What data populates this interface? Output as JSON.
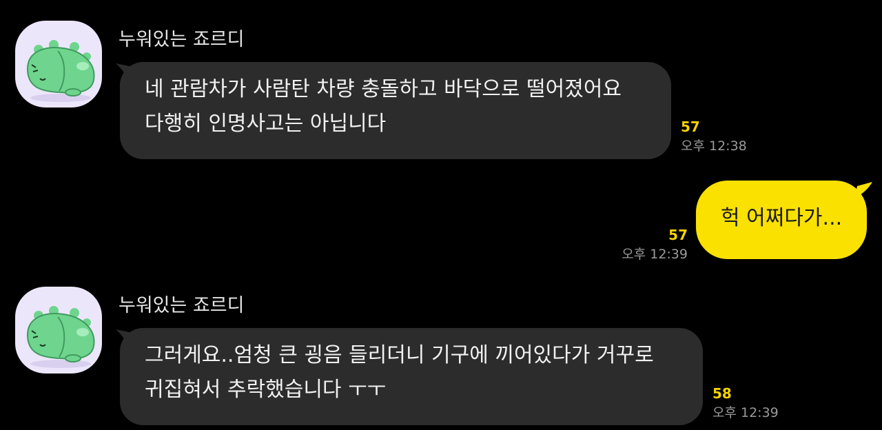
{
  "messages": [
    {
      "sender": "누워있는 죠르디",
      "lines": [
        "네 관람차가 사람탄 차량 충돌하고 바닥으로 떨어졌어요",
        "다행히 인명사고는 아닙니다"
      ],
      "unread": "57",
      "time": "오후 12:38"
    },
    {
      "lines": [
        "헉 어쩌다가..."
      ],
      "unread": "57",
      "time": "오후 12:39"
    },
    {
      "sender": "누워있는 죠르디",
      "lines": [
        "그러게요..엄청 큰 굉음 들리더니 기구에 끼어있다가 거꾸로",
        "귀집혀서 추락했습니다 ㅜㅜ"
      ],
      "unread": "58",
      "time": "오후 12:39"
    }
  ],
  "colors": {
    "background": "#000000",
    "incoming_bubble": "#2c2c2c",
    "outgoing_bubble": "#fae100",
    "unread_count": "#f5d400",
    "avatar_bg": "#ece6fb",
    "character": "#6fd58e"
  },
  "icons": {
    "avatar": "jordy-dinosaur-avatar-icon"
  }
}
